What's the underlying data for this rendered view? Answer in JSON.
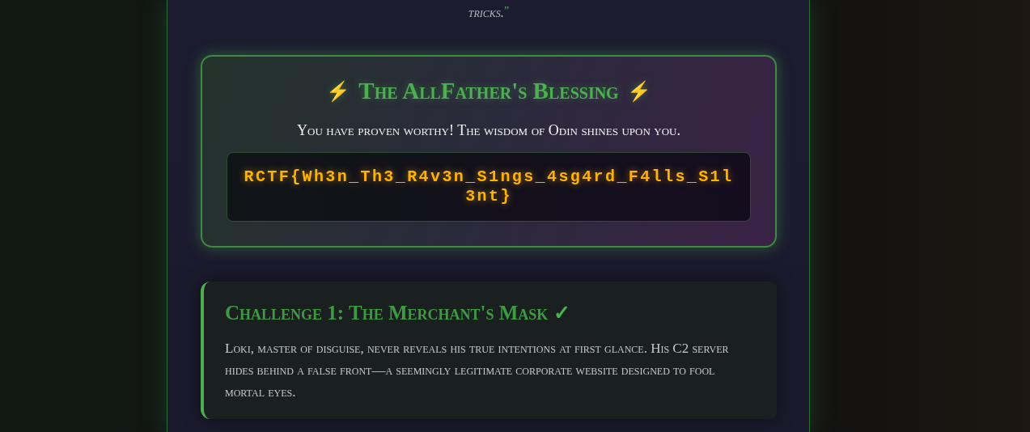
{
  "intro": {
    "text": "tricks.",
    "quote_mark": "”"
  },
  "blessing": {
    "icon_left": "⚡",
    "title": "The AllFather's Blessing",
    "icon_right": "⚡",
    "message": "You have proven worthy! The wisdom of Odin shines upon you.",
    "flag": "RCTF{Wh3n_Th3_R4v3n_S1ngs_4sg4rd_F4lls_S1l3nt}"
  },
  "challenges": [
    {
      "title": "Challenge 1: The Merchant's Mask",
      "solved": true,
      "check": "✓",
      "description": "Loki, master of disguise, never reveals his true intentions at first glance. His C2 server hides behind a false front—a seemingly legitimate corporate website designed to fool mortal eyes."
    }
  ]
}
